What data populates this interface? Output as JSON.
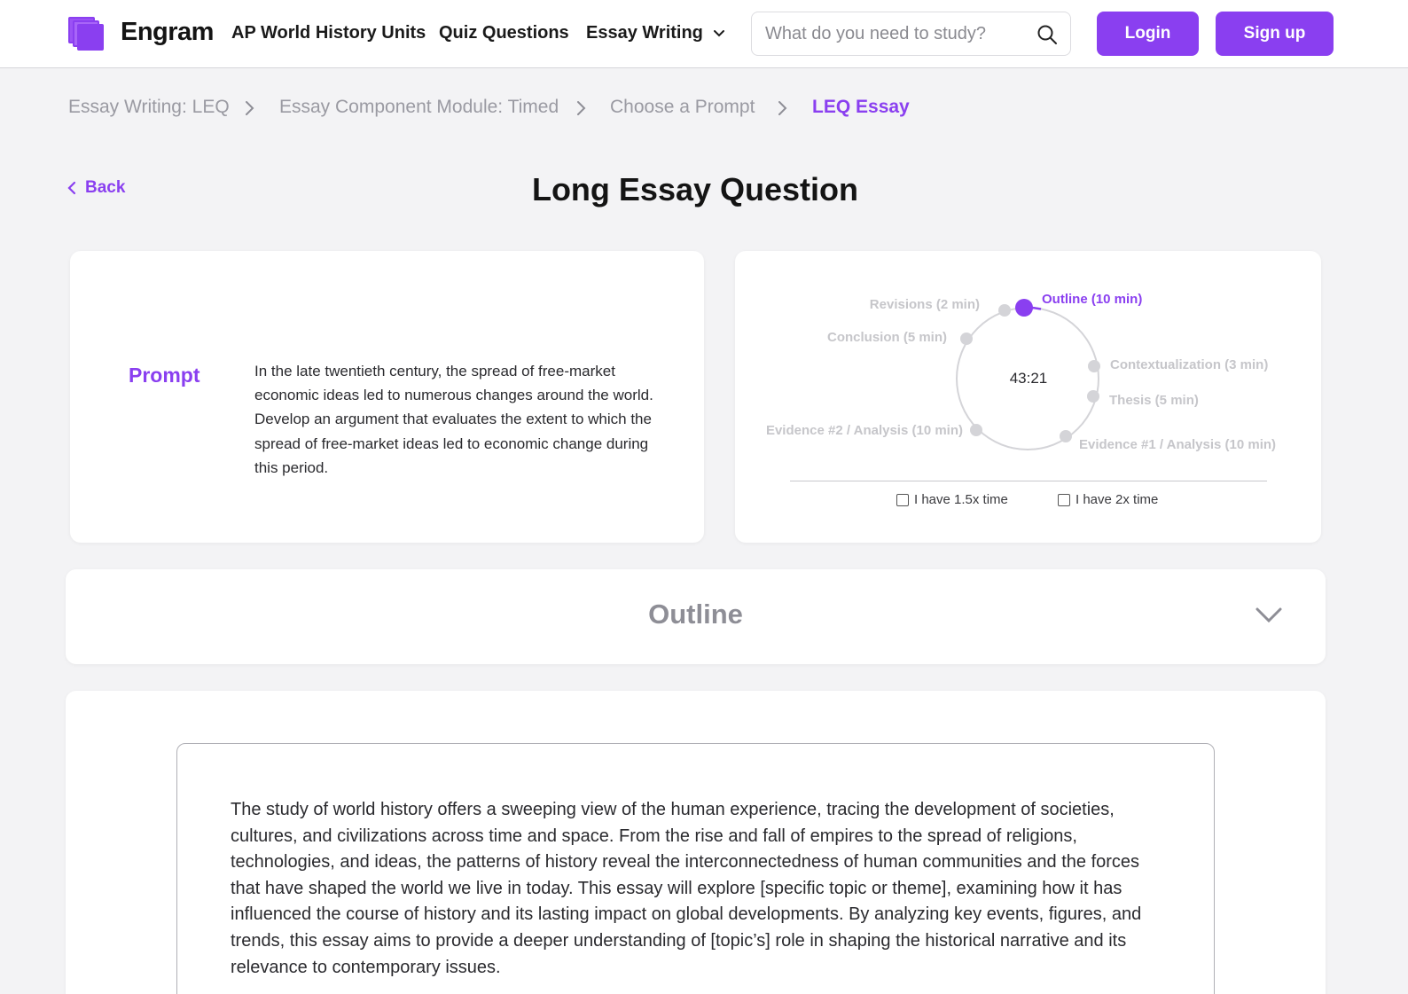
{
  "header": {
    "brand": "Engram",
    "nav": {
      "units": "AP World History Units",
      "quiz": "Quiz Questions",
      "essay": "Essay Writing"
    },
    "search_placeholder": "What do you need to study?",
    "login": "Login",
    "signup": "Sign up"
  },
  "breadcrumb": {
    "items": [
      "Essay Writing: LEQ",
      "Essay Component Module: Timed",
      "Choose a Prompt",
      "LEQ Essay"
    ]
  },
  "back_label": "Back",
  "page_title": "Long Essay Question",
  "prompt": {
    "label": "Prompt",
    "text": "In the late twentieth century, the spread of free-market economic ideas led to numerous changes around the world. Develop an argument that evaluates the extent to which the spread of free-market ideas led to economic change during this period."
  },
  "timer": {
    "time": "43:21",
    "active_step": "Outline (10 min)",
    "steps": {
      "outline": "Outline (10 min)",
      "contextualization": "Contextualization (3 min)",
      "thesis": "Thesis (5 min)",
      "evidence1": "Evidence #1 / Analysis (10 min)",
      "evidence2": "Evidence #2 / Analysis (10 min)",
      "conclusion": "Conclusion (5 min)",
      "revisions": "Revisions (2 min)"
    },
    "option_15x": "I have 1.5x time",
    "option_2x": "I have 2x time"
  },
  "outline": {
    "title": "Outline"
  },
  "essay": {
    "text": "The study of world history offers a sweeping view of the human experience, tracing the development of societies, cultures, and civilizations across time and space. From the rise and fall of empires to the spread of religions, technologies, and ideas, the patterns of history reveal the interconnectedness of human communities and the forces that have shaped the world we live in today. This essay will explore [specific topic or theme], examining how it has influenced the course of history and its lasting impact on global developments. By analyzing key events, figures, and trends, this essay aims to provide a deeper understanding of [topic’s] role in shaping the historical narrative and its relevance to contemporary issues."
  },
  "colors": {
    "accent": "#8a3ff0",
    "inactive_dot": "#d4d4d8",
    "inactive_label": "#c6c6ca"
  }
}
